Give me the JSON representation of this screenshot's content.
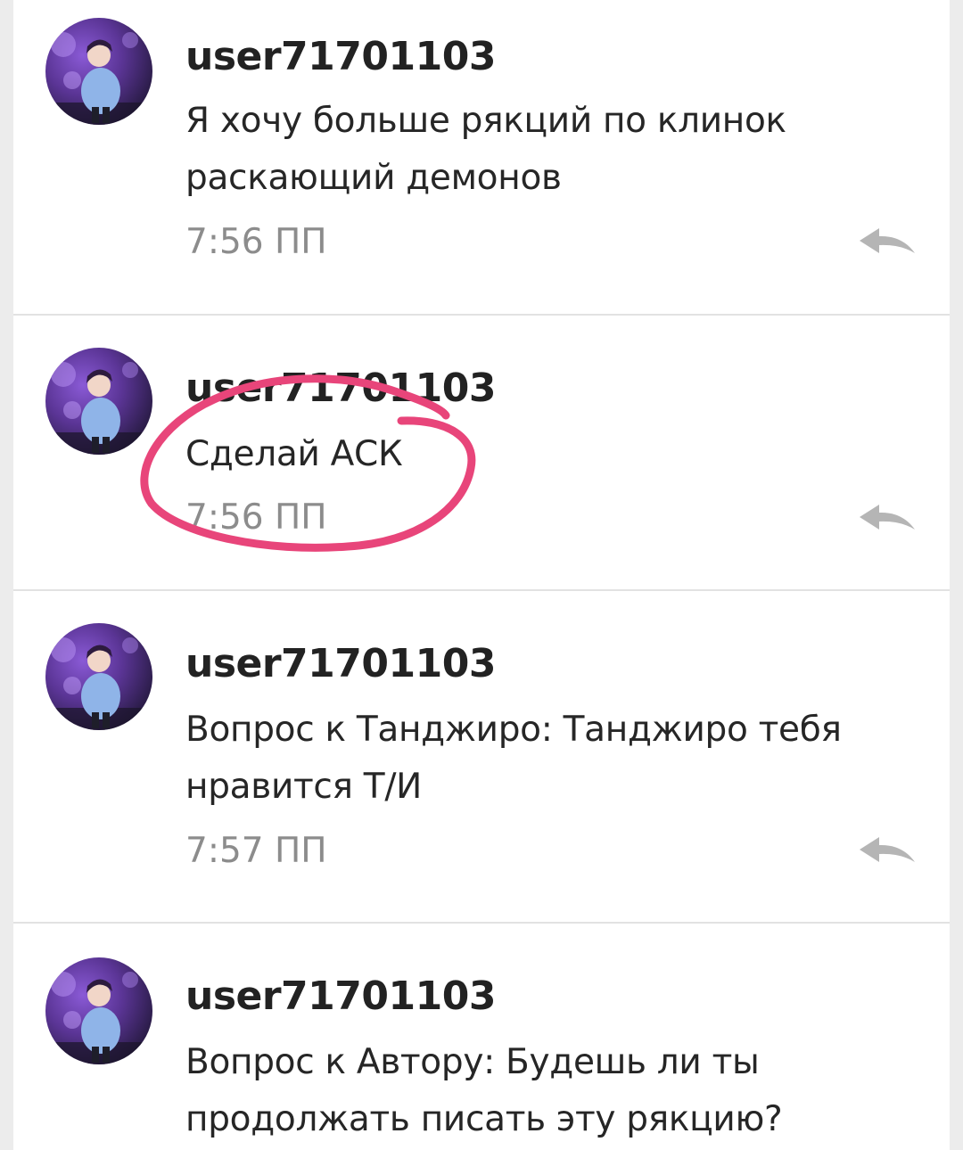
{
  "comments": [
    {
      "username": "user71701103",
      "text": "Я хочу больше рякций по клинок раскающий демонов",
      "time": "7:56 ПП",
      "avatar_icon": "anime-character-avatar",
      "reply_icon": "reply-arrow-icon"
    },
    {
      "username": "user71701103",
      "text": "Сделай АСК",
      "time": "7:56 ПП",
      "avatar_icon": "anime-character-avatar",
      "reply_icon": "reply-arrow-icon"
    },
    {
      "username": "user71701103",
      "text": "Вопрос к Танджиро: Танджиро тебя нравится Т/И",
      "time": "7:57 ПП",
      "avatar_icon": "anime-character-avatar",
      "reply_icon": "reply-arrow-icon"
    },
    {
      "username": "user71701103",
      "text": "Вопрос к Автору: Будешь ли ты продолжать писать эту рякцию?",
      "time": "",
      "avatar_icon": "anime-character-avatar",
      "reply_icon": "reply-arrow-icon"
    }
  ],
  "colors": {
    "username": "#222222",
    "message": "#262626",
    "time": "#8c8c8c",
    "reply_icon": "#b5b5b5",
    "highlight": "#e8457a",
    "divider": "#e2e2e2",
    "background": "#ececec",
    "card": "#ffffff"
  }
}
